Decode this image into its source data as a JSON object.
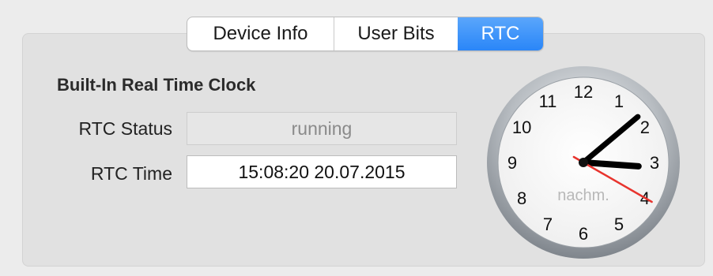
{
  "tabs": [
    {
      "label": "Device Info",
      "active": false
    },
    {
      "label": "User Bits",
      "active": false
    },
    {
      "label": "RTC",
      "active": true
    }
  ],
  "section": {
    "title": "Built-In Real Time Clock"
  },
  "rtc_status": {
    "label": "RTC Status",
    "value": "running"
  },
  "rtc_time": {
    "label": "RTC Time",
    "value": "15:08:20 20.07.2015"
  },
  "clock": {
    "numbers": [
      "12",
      "1",
      "2",
      "3",
      "4",
      "5",
      "6",
      "7",
      "8",
      "9",
      "10",
      "11"
    ],
    "period": "nachm.",
    "hour": 3,
    "minute": 8,
    "second": 20,
    "hand_color": "#000000",
    "second_hand_color": "#e8342e"
  },
  "colors": {
    "accent": "#2a86f8",
    "panel": "#e1e1e1",
    "background": "#ececec"
  }
}
